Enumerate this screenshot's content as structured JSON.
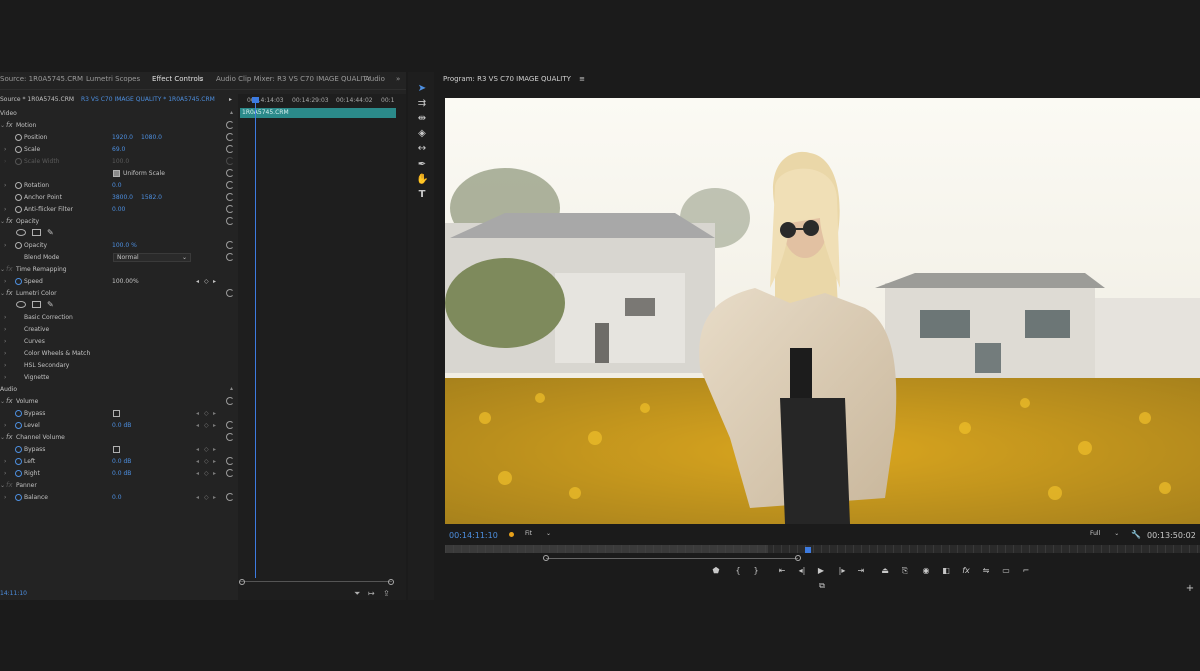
{
  "panel_tabs": {
    "source": "Source: 1R0A5745.CRM",
    "lumetri_scopes": "Lumetri Scopes",
    "effect_controls": "Effect Controls",
    "audio_clip_mixer": "Audio Clip Mixer: R3 VS C70 IMAGE QUALITY",
    "audio": "Audio",
    "more": "»"
  },
  "source_row": {
    "source": "Source * 1R0A5745.CRM",
    "sequence": "R3 VS C70 IMAGE QUALITY * 1R0A5745.CRM"
  },
  "ruler": {
    "t0": "00:14:14:03",
    "t1": "00:14:29:03",
    "t2": "00:14:44:02",
    "t3": "00:1"
  },
  "clip_name": "1R0A5745.CRM",
  "effects": {
    "video_header": "Video",
    "motion": "Motion",
    "position": "Position",
    "position_x": "1920.0",
    "position_y": "1080.0",
    "scale": "Scale",
    "scale_val": "69.0",
    "scale_width": "Scale Width",
    "scale_width_val": "100.0",
    "uniform_scale": "Uniform Scale",
    "rotation": "Rotation",
    "rotation_val": "0.0",
    "anchor_point": "Anchor Point",
    "anchor_x": "3800.0",
    "anchor_y": "1582.0",
    "anti_flicker": "Anti-flicker Filter",
    "anti_flicker_val": "0.00",
    "opacity": "Opacity",
    "opacity_val": "100.0 %",
    "blend_mode": "Blend Mode",
    "blend_mode_val": "Normal",
    "time_remapping": "Time Remapping",
    "speed": "Speed",
    "speed_val": "100.00%",
    "lumetri_color": "Lumetri Color",
    "basic_correction": "Basic Correction",
    "creative": "Creative",
    "curves": "Curves",
    "color_wheels": "Color Wheels & Match",
    "hsl_secondary": "HSL Secondary",
    "vignette": "Vignette",
    "audio_header": "Audio",
    "volume": "Volume",
    "bypass": "Bypass",
    "level": "Level",
    "level_val": "0.0 dB",
    "channel_volume": "Channel Volume",
    "bypass2": "Bypass",
    "left": "Left",
    "left_val": "0.0 dB",
    "right": "Right",
    "right_val": "0.0 dB",
    "panner": "Panner",
    "balance": "Balance",
    "balance_val": "0.0"
  },
  "ec_footer_tc": "14:11:10",
  "program": {
    "title": "Program: R3 VS C70 IMAGE QUALITY",
    "timecode_current": "00:14:11:10",
    "fit": "Fit",
    "full": "Full",
    "timecode_duration": "00:13:50:02"
  },
  "colors": {
    "accent": "#4d8fe0",
    "clip": "#2b8a8a"
  }
}
